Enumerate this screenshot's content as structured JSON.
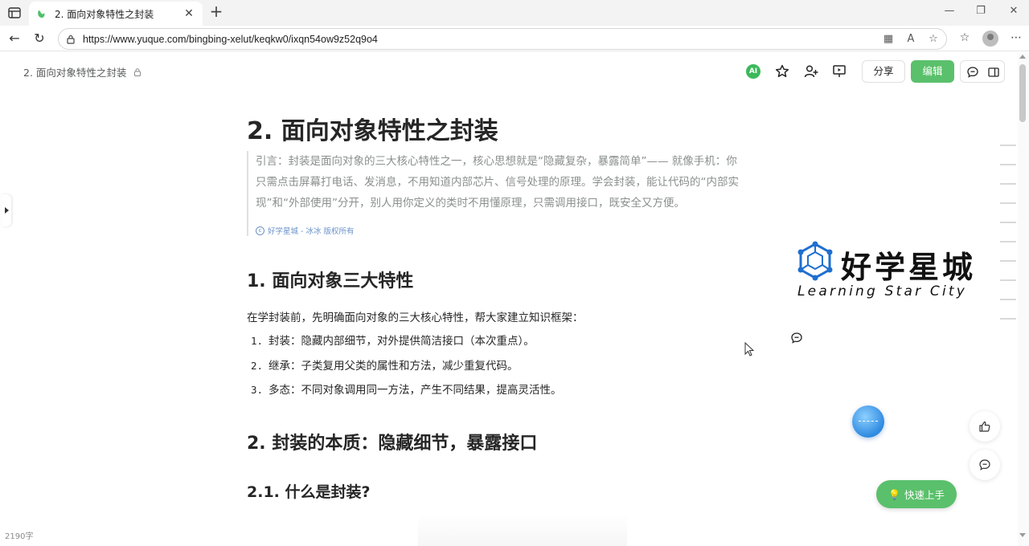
{
  "browser": {
    "tab_title": "2. 面向对象特性之封装",
    "url": "https://www.yuque.com/bingbing-xelut/keqkw0/ixqn54ow9z52q9o4"
  },
  "header": {
    "breadcrumb": "2. 面向对象特性之封装",
    "ai_label": "AI",
    "share_label": "分享",
    "edit_label": "编辑"
  },
  "doc": {
    "title": "2. 面向对象特性之封装",
    "quote_lines": [
      "引言：封装是面向对象的三大核心特性之一，核心思想就是“隐藏复杂，暴露简单”—— 就像手机：你",
      "只需点击屏幕打电话、发消息，不用知道内部芯片、信号处理的原理。学会封装，能让代码的“内部实",
      "现”和“外部使用”分开，别人用你定义的类时不用懂原理，只需调用接口，既安全又方便。"
    ],
    "quote_source": "好学星城 - 冰冰 版权所有",
    "h2_1": "1. 面向对象三大特性",
    "intro": "在学封装前，先明确面向对象的三大核心特性，帮大家建立知识框架：",
    "list": [
      {
        "num": "1.",
        "text": "封装：隐藏内部细节，对外提供简洁接口（本次重点）。"
      },
      {
        "num": "2.",
        "text": "继承：子类复用父类的属性和方法，减少重复代码。"
      },
      {
        "num": "3.",
        "text": "多态：不同对象调用同一方法，产生不同结果，提高灵活性。"
      }
    ],
    "h2_2": "2. 封装的本质：隐藏细节，暴露接口",
    "h3_1": "2.1. 什么是封装?"
  },
  "logo": {
    "cn": "好学星城",
    "en": "Learning Star City"
  },
  "footer": {
    "word_count": "2190字",
    "quick_start": "快速上手"
  },
  "colors": {
    "accent_green": "#5ac06b",
    "quote_text": "#8a8f8d",
    "link_blue": "#6c93c9"
  }
}
